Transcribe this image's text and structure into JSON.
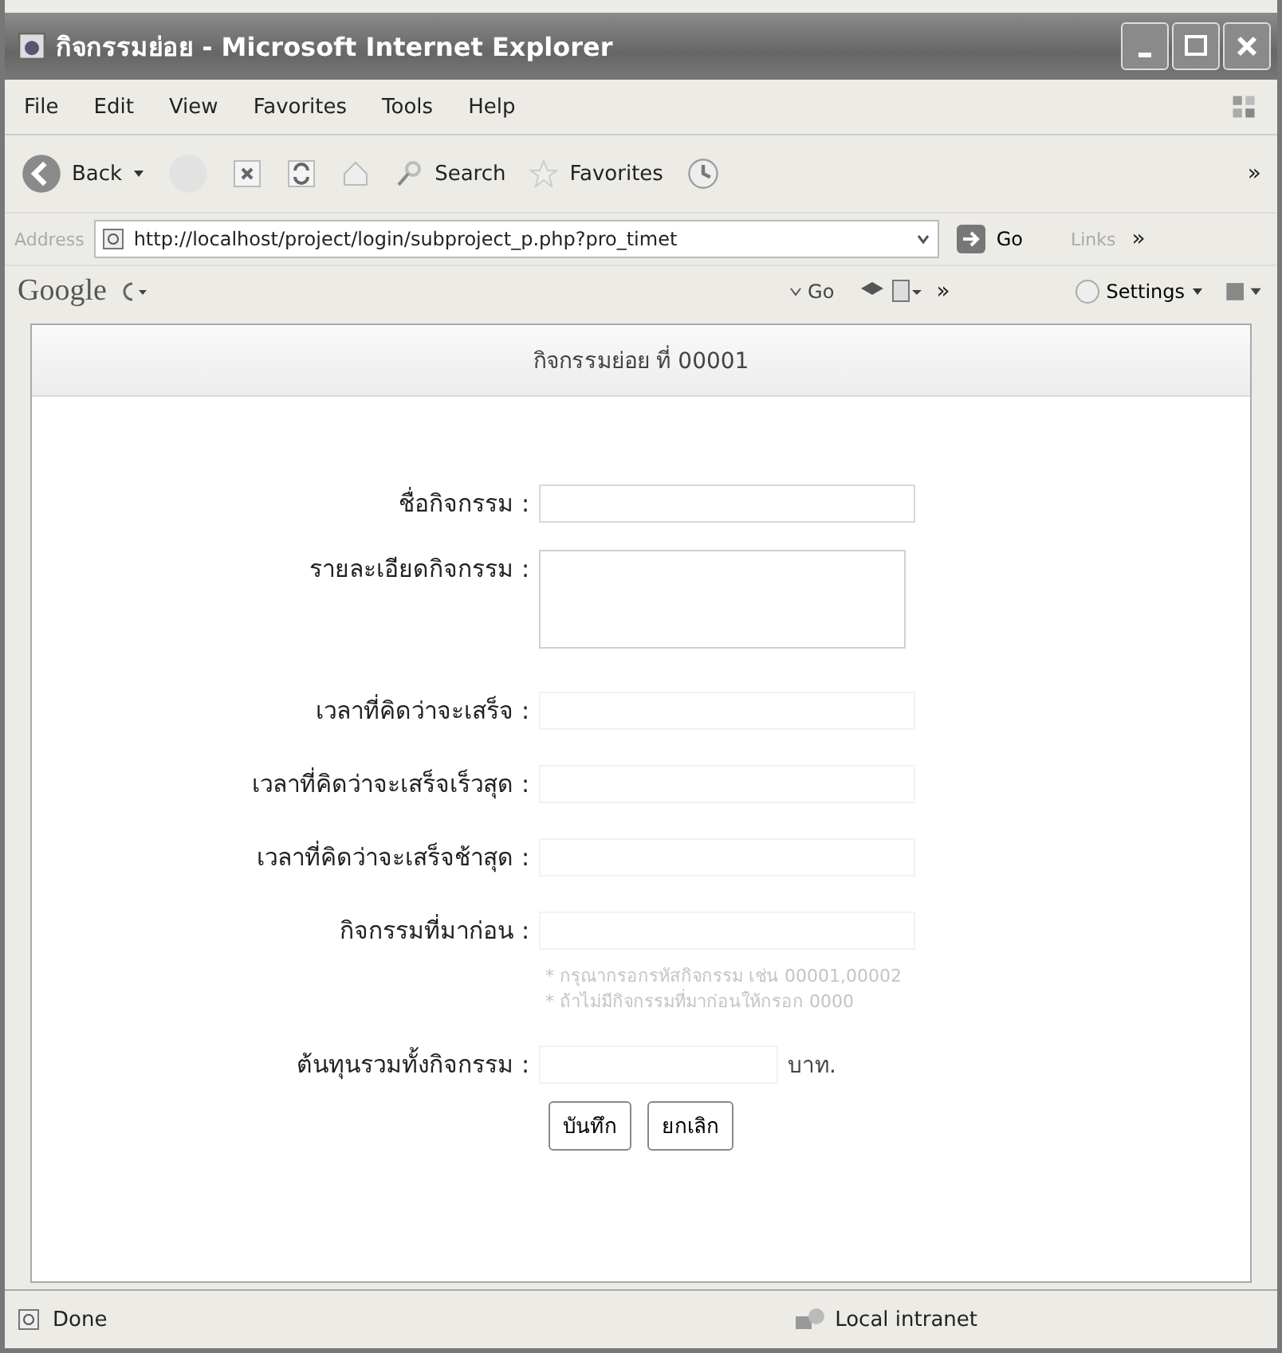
{
  "window": {
    "title": "กิจกรรมย่อย - Microsoft Internet Explorer"
  },
  "menu": [
    "File",
    "Edit",
    "View",
    "Favorites",
    "Tools",
    "Help"
  ],
  "toolbar": [
    {
      "kind": "back",
      "label": "Back"
    },
    {
      "kind": "forward"
    },
    {
      "kind": "stop"
    },
    {
      "kind": "refresh"
    },
    {
      "kind": "home"
    },
    {
      "kind": "search",
      "label": "Search"
    },
    {
      "kind": "favorites",
      "label": "Favorites"
    },
    {
      "kind": "history"
    }
  ],
  "toolbar_more": "»",
  "address": {
    "label": "Address",
    "url": "http://localhost/project/login/subproject_p.php?pro_timet",
    "go": "Go",
    "links": "Links",
    "more": "»"
  },
  "google_bar": {
    "logo": "Google",
    "go": "Go",
    "more": "»",
    "settings": "Settings"
  },
  "page": {
    "heading": "กิจกรรมย่อย ที่ 00001",
    "fields": [
      {
        "label": "ชื่อกิจกรรม :",
        "kind": "input"
      },
      {
        "label": "รายละเอียดกิจกรรม :",
        "kind": "textarea"
      },
      {
        "label": "เวลาที่คิดว่าจะเสร็จ :",
        "kind": "faint"
      },
      {
        "label": "เวลาที่คิดว่าจะเสร็จเร็วสุด :",
        "kind": "faint"
      },
      {
        "label": "เวลาที่คิดว่าจะเสร็จช้าสุด :",
        "kind": "faint"
      },
      {
        "label": "กิจกรรมที่มาก่อน :",
        "kind": "faint"
      }
    ],
    "hints": [
      "* กรุณากรอกรหัสกิจกรรม เช่น 00001,00002",
      "* ถ้าไม่มีกิจกรรมที่มาก่อนให้กรอก 0000"
    ],
    "cost": {
      "label": "ต้นทุนรวมทั้งกิจกรรม :",
      "unit": "บาท."
    },
    "buttons": [
      "บันทึก",
      "ยกเลิก"
    ]
  },
  "status_bar": {
    "text": "Done",
    "zone": "Local intranet"
  }
}
